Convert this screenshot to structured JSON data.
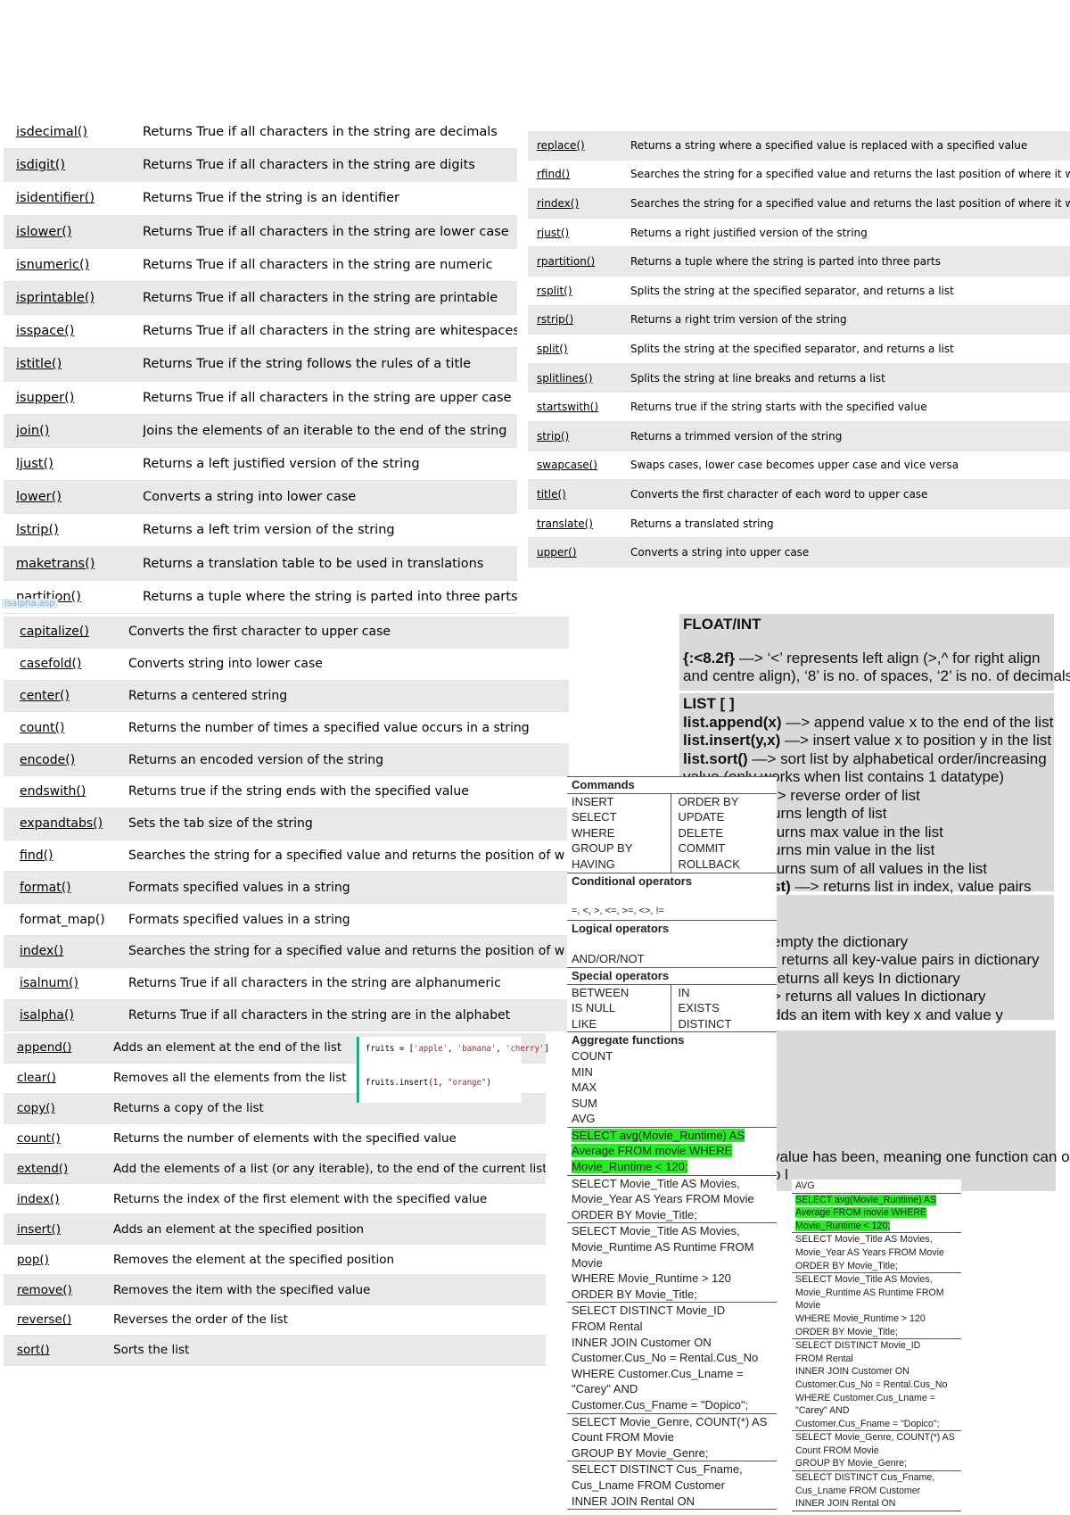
{
  "string_methods_a": [
    {
      "method": "isdecimal()",
      "desc": "Returns True if all characters in the string are decimals"
    },
    {
      "method": "isdigit()",
      "desc": "Returns True if all characters in the string are digits"
    },
    {
      "method": "isidentifier()",
      "desc": "Returns True if the string is an identifier"
    },
    {
      "method": "islower()",
      "desc": "Returns True if all characters in the string are lower case"
    },
    {
      "method": "isnumeric()",
      "desc": "Returns True if all characters in the string are numeric"
    },
    {
      "method": "isprintable()",
      "desc": "Returns True if all characters in the string are printable"
    },
    {
      "method": "isspace()",
      "desc": "Returns True if all characters in the string are whitespaces"
    },
    {
      "method": "istitle()",
      "desc": "Returns True if the string follows the rules of a title"
    },
    {
      "method": "isupper()",
      "desc": "Returns True if all characters in the string are upper case"
    },
    {
      "method": "join()",
      "desc": "Joins the elements of an iterable to the end of the string"
    },
    {
      "method": "ljust()",
      "desc": "Returns a left justified version of the string"
    },
    {
      "method": "lower()",
      "desc": "Converts a string into lower case"
    },
    {
      "method": "lstrip()",
      "desc": "Returns a left trim version of the string"
    },
    {
      "method": "maketrans()",
      "desc": "Returns a translation table to be used in translations"
    },
    {
      "method": "partition()",
      "desc": "Returns a tuple where the string is parted into three parts"
    }
  ],
  "tooltip": "isalpha.asp",
  "string_methods_b": [
    {
      "method": "replace()",
      "desc": "Returns a string where a specified value is replaced with a specified value"
    },
    {
      "method": "rfind()",
      "desc": "Searches the string for a specified value and returns the last position of where it was found"
    },
    {
      "method": "rindex()",
      "desc": "Searches the string for a specified value and returns the last position of where it was found"
    },
    {
      "method": "rjust()",
      "desc": "Returns a right justified version of the string"
    },
    {
      "method": "rpartition()",
      "desc": "Returns a tuple where the string is parted into three parts"
    },
    {
      "method": "rsplit()",
      "desc": "Splits the string at the specified separator, and returns a list"
    },
    {
      "method": "rstrip()",
      "desc": "Returns a right trim version of the string"
    },
    {
      "method": "split()",
      "desc": "Splits the string at the specified separator, and returns a list"
    },
    {
      "method": "splitlines()",
      "desc": "Splits the string at line breaks and returns a list"
    },
    {
      "method": "startswith()",
      "desc": "Returns true if the string starts with the specified value"
    },
    {
      "method": "strip()",
      "desc": "Returns a trimmed version of the string"
    },
    {
      "method": "swapcase()",
      "desc": "Swaps cases, lower case becomes upper case and vice versa"
    },
    {
      "method": "title()",
      "desc": "Converts the first character of each word to upper case"
    },
    {
      "method": "translate()",
      "desc": "Returns a translated string"
    },
    {
      "method": "upper()",
      "desc": "Converts a string into upper case"
    }
  ],
  "string_methods_c": [
    {
      "method": "capitalize()",
      "desc": "Converts the first character to upper case"
    },
    {
      "method": "casefold()",
      "desc": "Converts string into lower case"
    },
    {
      "method": "center()",
      "desc": "Returns a centered string"
    },
    {
      "method": "count()",
      "desc": "Returns the number of times a specified value occurs in a string"
    },
    {
      "method": "encode()",
      "desc": "Returns an encoded version of the string"
    },
    {
      "method": "endswith()",
      "desc": "Returns true if the string ends with the specified value"
    },
    {
      "method": "expandtabs()",
      "desc": "Sets the tab size of the string"
    },
    {
      "method": "find()",
      "desc": "Searches the string for a specified value and returns the position of w"
    },
    {
      "method": "format()",
      "desc": "Formats specified values in a string"
    },
    {
      "method": "format_map()",
      "desc": "Formats specified values in a string"
    },
    {
      "method": "index()",
      "desc": "Searches the string for a specified value and returns the position of w"
    },
    {
      "method": "isalnum()",
      "desc": "Returns True if all characters in the string are alphanumeric"
    },
    {
      "method": "isalpha()",
      "desc": "Returns True if all characters in the string are in the alphabet"
    }
  ],
  "list_methods": [
    {
      "method": "append()",
      "desc": "Adds an element at the end of the list"
    },
    {
      "method": "clear()",
      "desc": "Removes all the elements from the list"
    },
    {
      "method": "copy()",
      "desc": "Returns a copy of the list"
    },
    {
      "method": "count()",
      "desc": "Returns the number of elements with the specified value"
    },
    {
      "method": "extend()",
      "desc": "Add the elements of a list (or any iterable), to the end of the current list"
    },
    {
      "method": "index()",
      "desc": "Returns the index of the first element with the specified value"
    },
    {
      "method": "insert()",
      "desc": "Adds an element at the specified position"
    },
    {
      "method": "pop()",
      "desc": "Removes the element at the specified position"
    },
    {
      "method": "remove()",
      "desc": "Removes the item with the specified value"
    },
    {
      "method": "reverse()",
      "desc": "Reverses the order of the list"
    },
    {
      "method": "sort()",
      "desc": "Sorts the list"
    }
  ],
  "code_example": {
    "line1_prefix": "fruits = [",
    "line1_s1": "'apple'",
    "line1_s2": "'banana'",
    "line1_s3": "'cherry'",
    "line2_prefix": "fruits.insert(",
    "line2_num": "1",
    "line2_str": "\"orange\"",
    "accent_color": "#04aa6d"
  },
  "notes": {
    "float_title": "FLOAT/INT",
    "float_code": "{:<8.2f}",
    "float_desc1": " —> ‘<’ represents left align (>,^ for right align",
    "float_desc2": "and centre align), ‘8’ is no. of spaces, ‘2’ is no. of decimals",
    "list_title": "LIST [ ]",
    "list_lines": [
      {
        "b": "list.append(x)",
        "t": " —> append value x to the end of the list"
      },
      {
        "b": "list.insert(y,x)",
        "t": " —> insert value x to position y in the list"
      },
      {
        "b": "list.sort()",
        "t": " —> sort list by alphabetical order/increasing"
      },
      {
        "b": "",
        "t": "value (only works when list contains 1 datatype)"
      },
      {
        "b": "",
        "t": "-> reverse order of list"
      },
      {
        "b": "",
        "t": "urns length of list"
      },
      {
        "b": "",
        "t": "turns max value in the list"
      },
      {
        "b": "",
        "t": "urns min value in the list"
      },
      {
        "b": "",
        "t": "turns sum of all values in the list"
      },
      {
        "b": "st)",
        "t": " —> returns list in index, value pairs"
      }
    ],
    "dict_title": "}",
    "dict_lines": [
      "",
      "empty the dictionary",
      "· returns all key-value pairs in dictionary",
      "returns all keys In dictionary",
      "> returns all values In dictionary",
      "dds an item with key x and value y"
    ],
    "tail_line1": "value has been, meaning one function can only",
    "tail_line2": "o l"
  },
  "sql": {
    "commands_title": "Commands",
    "commands_left": [
      "INSERT",
      "SELECT",
      "WHERE",
      "GROUP BY",
      "HAVING"
    ],
    "commands_right": [
      "ORDER BY",
      "UPDATE",
      "DELETE",
      "COMMIT",
      "ROLLBACK"
    ],
    "conditional_title": "Conditional operators",
    "conditional_ops": "=, <, >, <=, >=, <>, !=",
    "logical_title": "Logical operators",
    "logical_ops": "AND/OR/NOT",
    "special_title": "Special operators",
    "special_left": [
      "BETWEEN",
      "IS NULL",
      "LIKE"
    ],
    "special_right": [
      "IN",
      "EXISTS",
      "DISTINCT"
    ],
    "aggregate_title": "Aggregate functions",
    "aggregate_list": [
      "COUNT",
      "MIN",
      "MAX",
      "SUM",
      "AVG"
    ],
    "highlight_color": "#22ee22",
    "queries": [
      {
        "lines": [
          "SELECT avg(Movie_Runtime) AS",
          "Average FROM movie WHERE",
          "Movie_Runtime < 120;"
        ],
        "highlight": true
      },
      {
        "lines": [
          "SELECT Movie_Title AS Movies,",
          "Movie_Year AS Years FROM Movie",
          "ORDER BY Movie_Title;"
        ],
        "highlight": false
      },
      {
        "lines": [
          "SELECT Movie_Title AS Movies,",
          "Movie_Runtime AS Runtime FROM",
          "Movie",
          "WHERE Movie_Runtime > 120",
          "ORDER BY Movie_Title;"
        ],
        "highlight": false
      },
      {
        "lines": [
          "SELECT DISTINCT Movie_ID",
          "FROM Rental",
          "INNER JOIN Customer ON",
          "Customer.Cus_No = Rental.Cus_No",
          "WHERE Customer.Cus_Lname =",
          "\"Carey\" AND",
          "Customer.Cus_Fname = \"Dopico\";"
        ],
        "highlight": false
      },
      {
        "lines": [
          "SELECT Movie_Genre, COUNT(*) AS",
          "Count FROM Movie",
          "GROUP BY Movie_Genre;"
        ],
        "highlight": false
      },
      {
        "lines": [
          "SELECT DISTINCT Cus_Fname,",
          "Cus_Lname FROM Customer",
          "INNER JOIN Rental ON"
        ],
        "highlight": false
      }
    ],
    "small_avg": "AVG"
  }
}
